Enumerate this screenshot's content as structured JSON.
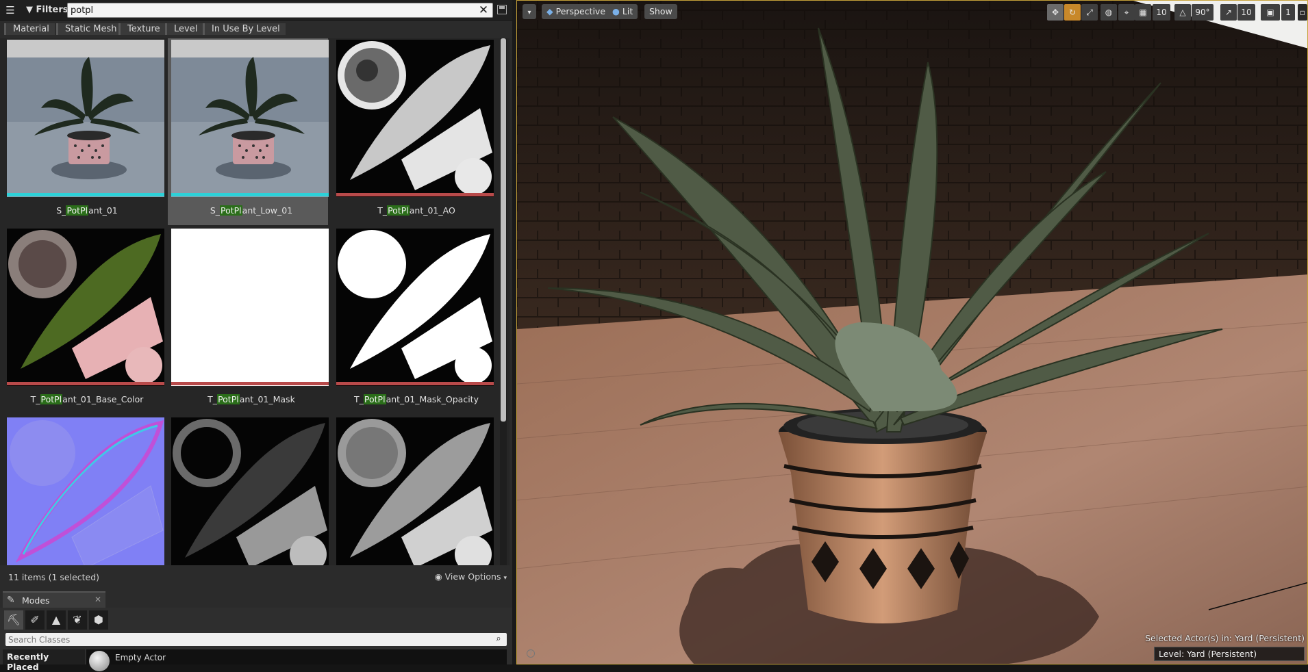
{
  "content_browser": {
    "filters_label": "Filters",
    "search": {
      "value": "potpl"
    },
    "filter_chips": [
      "Material",
      "Static Mesh",
      "Texture",
      "Level",
      "In Use By Level"
    ],
    "assets": [
      {
        "prefix": "S_",
        "match": "PotPl",
        "suffix": "ant_01",
        "type": "static-mesh",
        "bar_color": "#2dd1d8",
        "selected": false
      },
      {
        "prefix": "S_",
        "match": "PotPl",
        "suffix": "ant_Low_01",
        "type": "static-mesh",
        "bar_color": "#2dd1d8",
        "selected": true
      },
      {
        "prefix": "T_",
        "match": "PotPl",
        "suffix": "ant_01_AO",
        "type": "texture",
        "bar_color": "#b84a4a",
        "selected": false
      },
      {
        "prefix": "T_",
        "match": "PotPl",
        "suffix": "ant_01_Base_Color",
        "type": "texture",
        "bar_color": "#b84a4a",
        "selected": false
      },
      {
        "prefix": "T_",
        "match": "PotPl",
        "suffix": "ant_01_Mask",
        "type": "texture",
        "bar_color": "#b84a4a",
        "selected": false
      },
      {
        "prefix": "T_",
        "match": "PotPl",
        "suffix": "ant_01_Mask_Opacity",
        "type": "texture",
        "bar_color": "#b84a4a",
        "selected": false
      },
      {
        "type": "texture",
        "selected": false
      },
      {
        "type": "texture",
        "selected": false
      },
      {
        "type": "texture",
        "selected": false
      }
    ],
    "item_count": "11 items (1 selected)",
    "view_options": "View Options"
  },
  "modes": {
    "tab_label": "Modes",
    "mode_icons": [
      "place-mode-icon",
      "paint-mode-icon",
      "landscape-mode-icon",
      "foliage-mode-icon",
      "geometry-mode-icon"
    ],
    "search_placeholder": "Search Classes",
    "recently_placed": "Recently Placed",
    "first_item": "Empty Actor"
  },
  "viewport": {
    "perspective": "Perspective",
    "lit": "Lit",
    "show": "Show",
    "grid_snap": "10",
    "rotation_snap": "90°",
    "scale_snap": "10",
    "camera_speed": "1",
    "selected_actor": "Selected Actor(s) in:  Yard (Persistent)",
    "level": "Level:  Yard (Persistent)"
  },
  "colors": {
    "highlight": "#2b6e1a",
    "mesh_bar": "#2dd1d8",
    "texture_bar": "#b84a4a",
    "viewport_border": "#c6a239"
  }
}
